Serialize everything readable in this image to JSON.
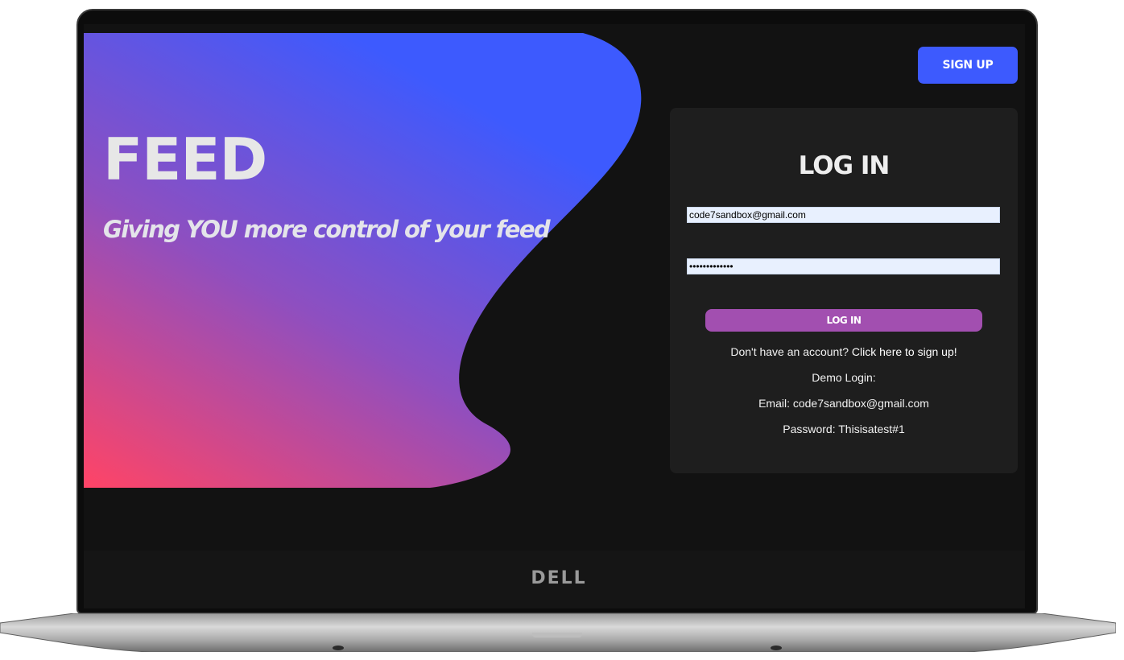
{
  "colors": {
    "gradient_start": "#ff4466",
    "gradient_mid": "#8e4fc0",
    "gradient_end": "#3d5afe",
    "signup_button": "#3d5afe",
    "login_button": "#a24fb0",
    "card_background": "#1e1e1e",
    "screen_background": "#121212"
  },
  "hero": {
    "title": "FEED",
    "tagline": "Giving YOU more control of your feed"
  },
  "header": {
    "signup_label": "SIGN UP"
  },
  "login": {
    "heading": "LOG IN",
    "email_value": "code7sandbox@gmail.com",
    "password_value": "Thisisatest#1",
    "button_label": "LOG IN",
    "signup_prompt": "Don't have an account?",
    "signup_link": "Click here to sign up!",
    "demo_label": "Demo Login:",
    "demo_email": "Email: code7sandbox@gmail.com",
    "demo_password": "Password: Thisisatest#1"
  },
  "device": {
    "brand": "DELL"
  }
}
